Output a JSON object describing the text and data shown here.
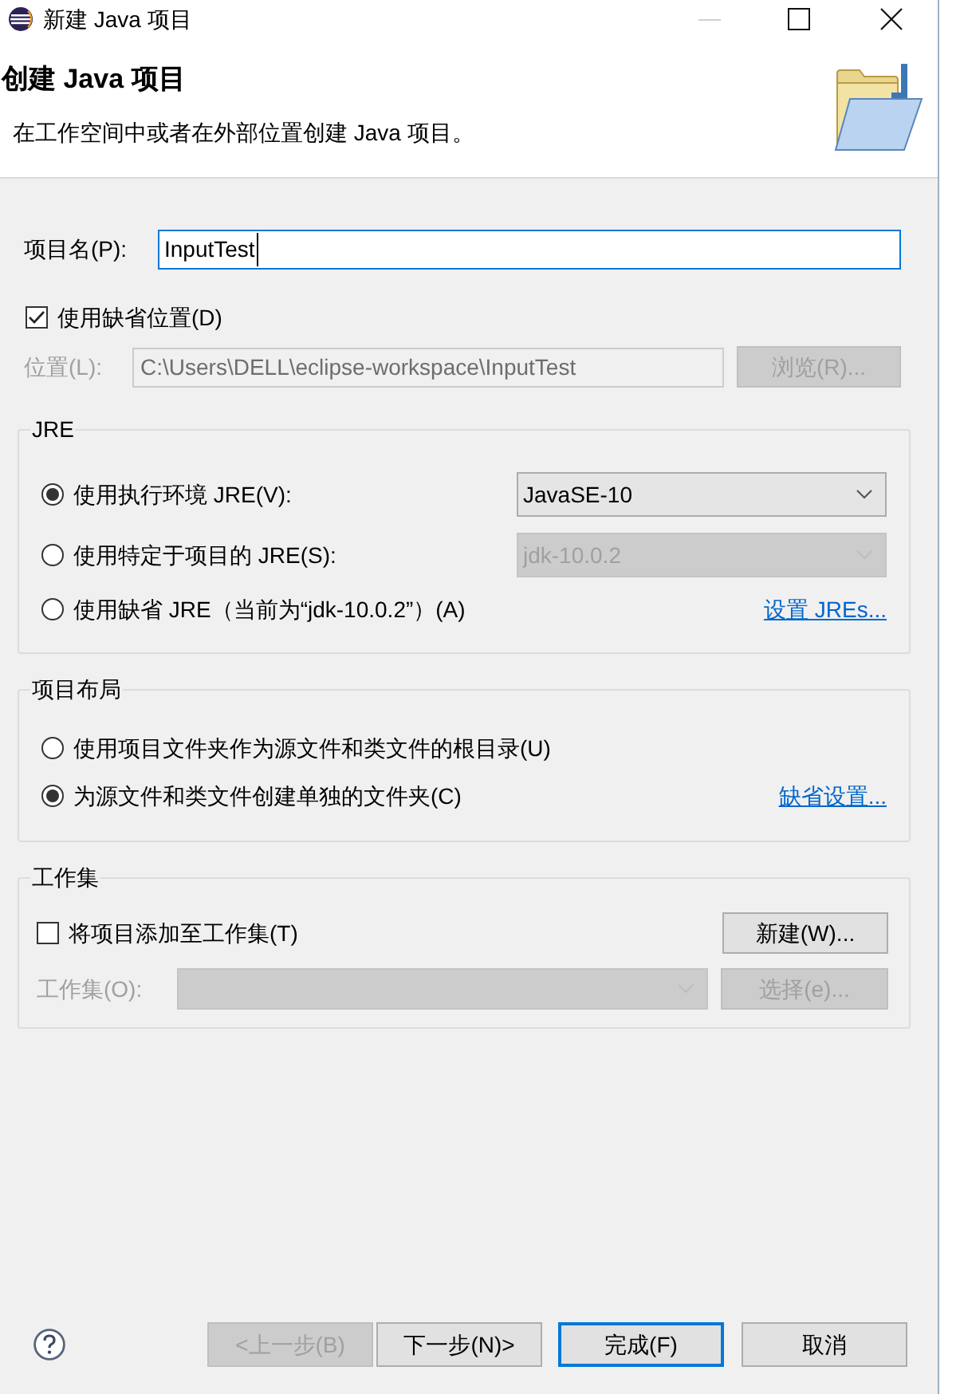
{
  "window": {
    "title": "新建 Java 项目"
  },
  "header": {
    "title": "创建 Java 项目",
    "description": "在工作空间中或者在外部位置创建 Java 项目。"
  },
  "project_name": {
    "label": "项目名(P):",
    "value": "InputTest",
    "focused": true
  },
  "default_location": {
    "label": "使用缺省位置(D)",
    "checked": true
  },
  "location": {
    "label": "位置(L):",
    "value": "C:\\Users\\DELL\\eclipse-workspace\\InputTest",
    "disabled": true,
    "browse_button": {
      "label": "浏览(R)...",
      "disabled": true
    }
  },
  "jre": {
    "title": "JRE",
    "options": [
      {
        "kind": "dropdown",
        "label": "使用执行环境 JRE(V):",
        "selected": true,
        "dropdown": {
          "value": "JavaSE-10",
          "disabled": false
        }
      },
      {
        "kind": "dropdown",
        "label": "使用特定于项目的 JRE(S):",
        "selected": false,
        "dropdown": {
          "value": "jdk-10.0.2",
          "disabled": true
        }
      },
      {
        "kind": "link",
        "label": "使用缺省 JRE（当前为“jdk-10.0.2”）(A)",
        "selected": false,
        "link": "设置 JREs..."
      }
    ]
  },
  "project_layout": {
    "title": "项目布局",
    "options": [
      {
        "kind": "plain",
        "label": "使用项目文件夹作为源文件和类文件的根目录(U)",
        "selected": false
      },
      {
        "kind": "link",
        "label": "为源文件和类文件创建单独的文件夹(C)",
        "selected": true,
        "link": "缺省设置..."
      }
    ]
  },
  "working_set": {
    "title": "工作集",
    "add": {
      "label": "将项目添加至工作集(T)",
      "checked": false
    },
    "new_button": {
      "label": "新建(W)...",
      "disabled": false
    },
    "sets": {
      "label": "工作集(O):",
      "disabled": true
    },
    "select_button": {
      "label": "选择(e)...",
      "disabled": true
    }
  },
  "footer": {
    "buttons": [
      {
        "label": "<上一步(B)",
        "disabled": true,
        "default": false
      },
      {
        "label": "下一步(N)>",
        "disabled": false,
        "default": false
      },
      {
        "label": "完成(F)",
        "disabled": false,
        "default": true
      },
      {
        "label": "取消",
        "disabled": false,
        "default": false
      }
    ]
  }
}
